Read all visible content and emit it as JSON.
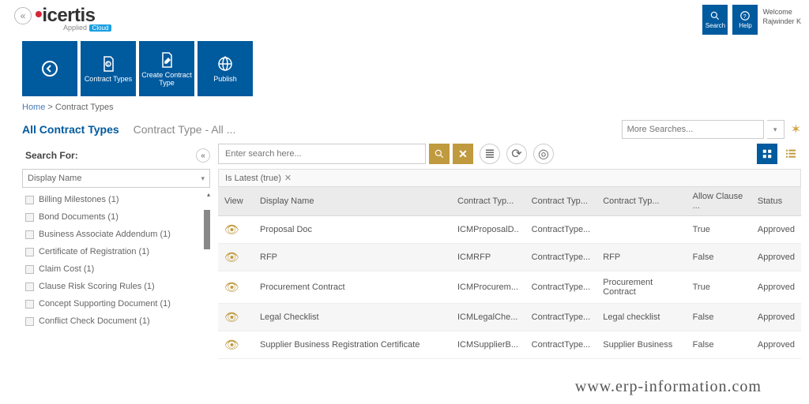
{
  "header": {
    "logo_text": "icertis",
    "logo_sub_a": "Applied",
    "logo_sub_b": "Cloud",
    "search_btn": "Search",
    "help_btn": "Help",
    "welcome_label": "Welcome",
    "welcome_user": "Rajwinder K"
  },
  "tiles": {
    "back": "",
    "contract_types": "Contract Types",
    "create": "Create Contract Type",
    "publish": "Publish"
  },
  "breadcrumb": {
    "home": "Home",
    "sep": " > ",
    "current": "Contract Types"
  },
  "tabs": {
    "active": "All Contract Types",
    "sub": "Contract Type - All ..."
  },
  "more_search_placeholder": "More Searches...",
  "left": {
    "search_for": "Search For:",
    "display_name": "Display Name",
    "items": [
      "Billing Milestones (1)",
      "Bond Documents (1)",
      "Business Associate Addendum (1)",
      "Certificate of Registration (1)",
      "Claim Cost (1)",
      "Clause Risk Scoring Rules (1)",
      "Concept Supporting Document (1)",
      "Conflict Check Document (1)"
    ]
  },
  "grid": {
    "search_placeholder": "Enter search here...",
    "filter_chip": "Is Latest (true)",
    "columns": [
      "View",
      "Display Name",
      "Contract Typ...",
      "Contract Typ...",
      "Contract Typ...",
      "Allow Clause ...",
      "Status"
    ],
    "rows": [
      {
        "name": "Proposal Doc",
        "c1": "ICMProposalD..",
        "c2": "ContractType...",
        "c3": "",
        "allow": "True",
        "status": "Approved"
      },
      {
        "name": "RFP",
        "c1": "ICMRFP",
        "c2": "ContractType...",
        "c3": "RFP",
        "allow": "False",
        "status": "Approved"
      },
      {
        "name": "Procurement Contract",
        "c1": "ICMProcurem...",
        "c2": "ContractType...",
        "c3": "Procurement Contract",
        "allow": "True",
        "status": "Approved"
      },
      {
        "name": "Legal Checklist",
        "c1": "ICMLegalChe...",
        "c2": "ContractType...",
        "c3": "Legal checklist",
        "allow": "False",
        "status": "Approved"
      },
      {
        "name": "Supplier Business Registration Certificate",
        "c1": "ICMSupplierB...",
        "c2": "ContractType...",
        "c3": "Supplier Business",
        "allow": "False",
        "status": "Approved"
      }
    ]
  },
  "watermark": "www.erp-information.com"
}
